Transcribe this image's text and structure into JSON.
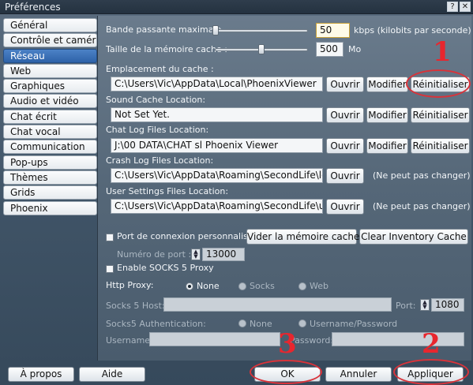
{
  "window": {
    "title": "Préférences",
    "help_glyph": "?",
    "close_glyph": "✕"
  },
  "tabs": [
    {
      "label": "Général"
    },
    {
      "label": "Contrôle et caméra"
    },
    {
      "label": "Réseau"
    },
    {
      "label": "Web"
    },
    {
      "label": "Graphiques"
    },
    {
      "label": "Audio et vidéo"
    },
    {
      "label": "Chat écrit"
    },
    {
      "label": "Chat vocal"
    },
    {
      "label": "Communication"
    },
    {
      "label": "Pop-ups"
    },
    {
      "label": "Thèmes"
    },
    {
      "label": "Grids"
    },
    {
      "label": "Phoenix"
    }
  ],
  "active_tab": "Réseau",
  "network": {
    "bandwidth_label": "Bande passante maximale",
    "bandwidth_value": "50",
    "bandwidth_unit": "kbps (kilobits par seconde)",
    "bandwidth_level": 0.01,
    "cache_label": "Taille de la mémoire cache :",
    "cache_value": "500",
    "cache_unit": "Mo",
    "cache_level": 0.5
  },
  "paths": {
    "cache": {
      "label": "Emplacement du cache :",
      "value": "C:\\Users\\Vic\\AppData\\Local\\PhoenixViewer",
      "open": "Ouvrir",
      "modify": "Modifier",
      "reset": "Réinitialiser"
    },
    "sound": {
      "label": "Sound Cache Location:",
      "value": "Not Set Yet.",
      "open": "Ouvrir",
      "modify": "Modifier",
      "reset": "Réinitialiser"
    },
    "chatlog": {
      "label": "Chat Log Files Location:",
      "value": "J:\\00 DATA\\CHAT sl Phoenix Viewer",
      "open": "Ouvrir",
      "modify": "Modifier",
      "reset": "Réinitialiser"
    },
    "crashlog": {
      "label": "Crash Log Files Location:",
      "value": "C:\\Users\\Vic\\AppData\\Roaming\\SecondLife\\logs",
      "open": "Ouvrir",
      "note": "(Ne peut pas changer)"
    },
    "usersettings": {
      "label": "User Settings Files Location:",
      "value": "C:\\Users\\Vic\\AppData\\Roaming\\SecondLife\\user",
      "open": "Ouvrir",
      "note": "(Ne peut pas changer)"
    }
  },
  "port": {
    "custom_label": "Port de connexion personnalisé",
    "custom_checked": false,
    "clear_cache": "Vider la mémoire cache",
    "clear_inventory": "Clear Inventory Cache",
    "number_label": "Numéro de port :",
    "number_value": "13000"
  },
  "proxy": {
    "socks_enable_label": "Enable SOCKS 5 Proxy",
    "socks_enable_checked": false,
    "http_label": "Http Proxy:",
    "http_options": [
      "None",
      "Socks",
      "Web"
    ],
    "http_selected": "None",
    "socks_host_label": "Socks 5 Host:",
    "socks_host_value": "",
    "port_label": "Port:",
    "port_value": "1080",
    "auth_label": "Socks5 Authentication:",
    "auth_options": [
      "None",
      "Username/Password"
    ],
    "auth_selected": "None",
    "username_label": "Username:",
    "username_value": "",
    "password_label": "Password:",
    "password_value": ""
  },
  "bottom": {
    "about": "À propos",
    "help": "Aide",
    "ok": "OK",
    "cancel": "Annuler",
    "apply": "Appliquer"
  },
  "annotations": [
    "1",
    "2",
    "3"
  ],
  "colors": {
    "active_tab": "#2d62a8",
    "annotation": "#e8262e"
  }
}
